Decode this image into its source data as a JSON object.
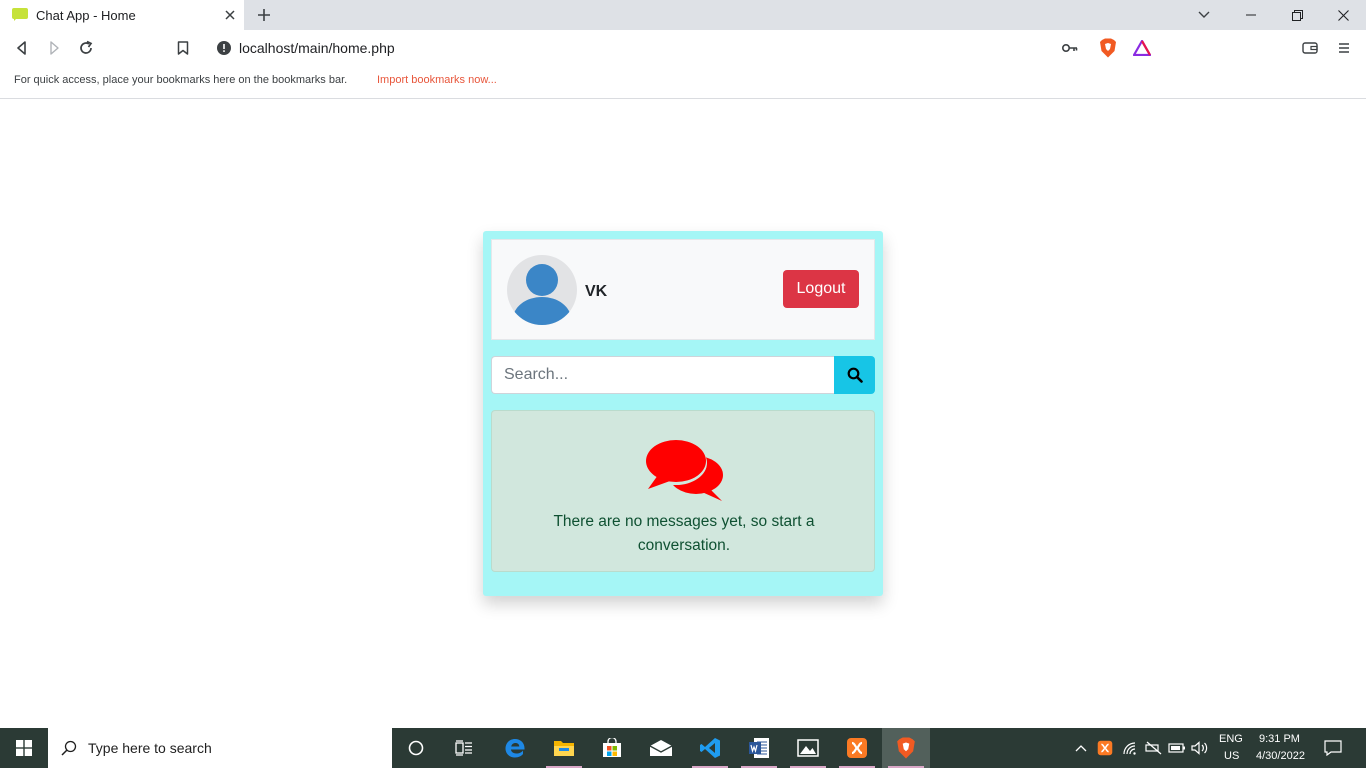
{
  "browser": {
    "tab_title": "Chat App - Home",
    "url": "localhost/main/home.php",
    "bookmarks_bar_text": "For quick access, place your bookmarks here on the bookmarks bar.",
    "bookmarks_bar_link": "Import bookmarks now..."
  },
  "profile": {
    "username": "VK",
    "logout_label": "Logout"
  },
  "search": {
    "placeholder": "Search..."
  },
  "conversations": {
    "empty_message": "There are no messages yet, so start a conversation."
  },
  "taskbar": {
    "search_placeholder": "Type here to search",
    "language": "ENG",
    "region": "US",
    "time": "9:31 PM",
    "date": "4/30/2022"
  },
  "colors": {
    "card_background": "#a5f6f6",
    "logout_button": "#dc3545",
    "search_button": "#17c5e6",
    "empty_state_background": "#d1e7dd",
    "chat_icon": "#ff0000",
    "avatar": "#3b86c7"
  }
}
